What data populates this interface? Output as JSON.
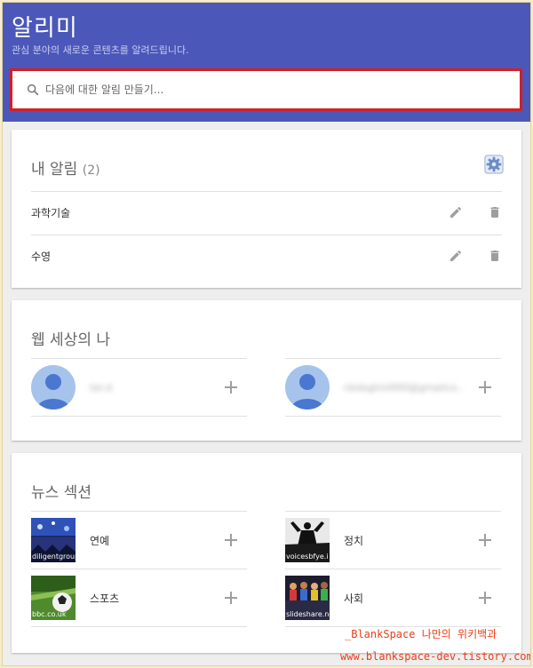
{
  "header": {
    "title": "알리미",
    "subtitle": "관심 분야의 새로운 콘텐츠를 알려드립니다."
  },
  "search": {
    "placeholder": "다음에 대한 알림 만들기...",
    "value": ""
  },
  "my_alerts": {
    "title": "내 알림",
    "count": "(2)",
    "items": [
      {
        "label": "과학기술"
      },
      {
        "label": "수영"
      }
    ]
  },
  "web_me": {
    "title": "웹 세상의 나",
    "accounts": [
      {
        "text": "ter.d"
      },
      {
        "text": "nbdsgtmi000@gmailco.."
      }
    ]
  },
  "news": {
    "title": "뉴스 섹션",
    "items": [
      {
        "label": "연예",
        "caption": "diligentgroup"
      },
      {
        "label": "정치",
        "caption": "voicesbfye.i"
      },
      {
        "label": "스포츠",
        "caption": "bbc.co.uk"
      },
      {
        "label": "사회",
        "caption": "slideshare.ne"
      }
    ]
  },
  "watermark": {
    "line1": "_BlankSpace 나만의 위키백과",
    "line2": "www.blankspace-dev.tistory.com"
  },
  "colors": {
    "header": "#4b57b9",
    "highlight_border": "#d21f27",
    "watermark": "#e8401d"
  }
}
